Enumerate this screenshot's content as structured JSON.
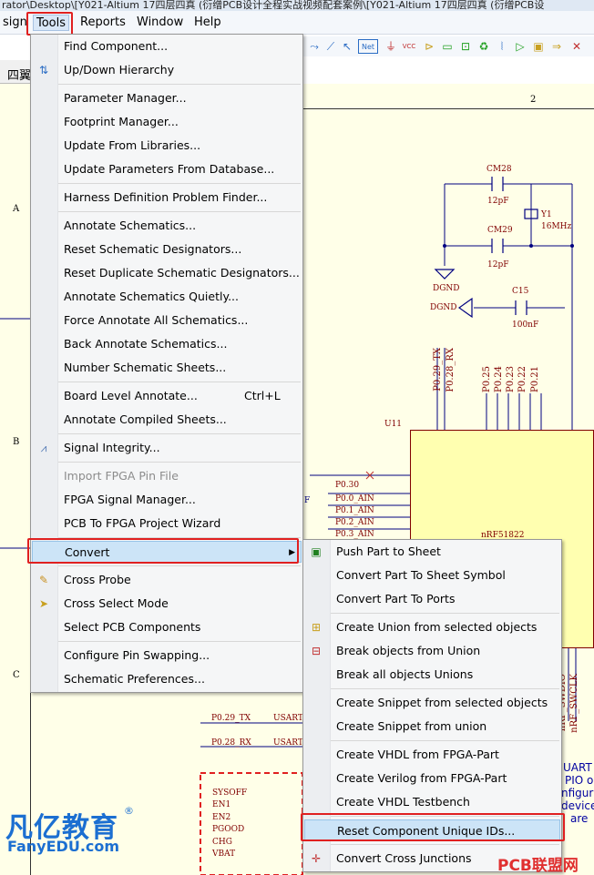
{
  "title_fragment": "rator\\Desktop\\[Y021-Altium 17四层四真 (衍缯PCB设计全程实战视频配套案例\\[Y021-Altium 17四层四真 (衍缯PCB设",
  "menubar": {
    "items": [
      {
        "label": "sign"
      },
      {
        "label": "Tools"
      },
      {
        "label": "Reports"
      },
      {
        "label": "Window"
      },
      {
        "label": "Help"
      }
    ]
  },
  "tab": {
    "label": "四翼"
  },
  "toolbar": {
    "net_label": "Net",
    "vcc_label": "VCC"
  },
  "frame": {
    "col2": "2",
    "row_a": "A",
    "row_b": "B",
    "row_c": "C"
  },
  "schematic": {
    "cm28": "CM28",
    "cm28_val": "12pF",
    "cm29": "CM29",
    "cm29_val": "12pF",
    "y1": "Y1",
    "y1_val": "16MHz",
    "dgnd1": "DGND",
    "dgnd2": "DGND",
    "c15": "C15",
    "c15_val": "100nF",
    "u11": "U11",
    "chip_name": "nRF51822",
    "pins_top": [
      "P0.29_TX",
      "P0.28_RX",
      "P0.25",
      "P0.24",
      "P0.23",
      "P0.22",
      "P0.21"
    ],
    "pins_left": [
      "P0.30",
      "P0.0_AIN",
      "P0.1_AIN",
      "P0.2_AIN",
      "P0.3_AIN"
    ],
    "pins_bottom": [
      "nRF_SWDIO",
      "nRF_SWCLK"
    ],
    "nets": [
      "P0.29_TX",
      "P0.28_RX"
    ],
    "usart": [
      "USART",
      "USART"
    ],
    "power": [
      "SYSOFF",
      "EN1",
      "EN2",
      "PGOOD",
      "CHG",
      "VBAT"
    ],
    "right_text": [
      "UART in",
      "PIO or",
      "nfigura",
      "device",
      "are"
    ],
    "f_label": "F"
  },
  "tools_menu": {
    "items": [
      {
        "label": "Find Component...",
        "icon": ""
      },
      {
        "label": "Up/Down Hierarchy",
        "icon": "updown-icon"
      },
      {
        "label": "Parameter Manager..."
      },
      {
        "label": "Footprint Manager..."
      },
      {
        "label": "Update From Libraries..."
      },
      {
        "label": "Update Parameters From Database..."
      },
      {
        "label": "Harness Definition Problem Finder..."
      },
      {
        "label": "Annotate Schematics..."
      },
      {
        "label": "Reset Schematic Designators..."
      },
      {
        "label": "Reset Duplicate Schematic Designators..."
      },
      {
        "label": "Annotate Schematics Quietly..."
      },
      {
        "label": "Force Annotate All Schematics..."
      },
      {
        "label": "Back Annotate Schematics..."
      },
      {
        "label": "Number Schematic Sheets..."
      },
      {
        "label": "Board Level Annotate...",
        "shortcut": "Ctrl+L"
      },
      {
        "label": "Annotate Compiled Sheets..."
      },
      {
        "label": "Signal Integrity...",
        "icon": "signal-integrity-icon"
      },
      {
        "label": "Import FPGA Pin File",
        "disabled": true
      },
      {
        "label": "FPGA Signal Manager..."
      },
      {
        "label": "PCB To FPGA Project Wizard"
      },
      {
        "label": "Convert",
        "submenu": true
      },
      {
        "label": "Cross Probe",
        "icon": "cross-probe-icon"
      },
      {
        "label": "Cross Select Mode",
        "icon": "cross-select-icon"
      },
      {
        "label": "Select PCB Components"
      },
      {
        "label": "Configure Pin Swapping..."
      },
      {
        "label": "Schematic Preferences..."
      }
    ]
  },
  "convert_menu": {
    "items": [
      {
        "label": "Push Part to Sheet",
        "icon": "push-part-icon"
      },
      {
        "label": "Convert Part To Sheet Symbol"
      },
      {
        "label": "Convert Part To Ports"
      },
      {
        "label": "Create Union from selected objects",
        "icon": "union-icon"
      },
      {
        "label": "Break objects from Union",
        "icon": "break-union-icon"
      },
      {
        "label": "Break all objects Unions"
      },
      {
        "label": "Create Snippet from selected objects"
      },
      {
        "label": "Create Snippet from union"
      },
      {
        "label": "Create VHDL from FPGA-Part"
      },
      {
        "label": "Create Verilog from FPGA-Part"
      },
      {
        "label": "Create VHDL Testbench"
      },
      {
        "label": "Reset Component Unique IDs..."
      },
      {
        "label": "Convert Cross Junctions",
        "icon": "cross-junction-icon"
      }
    ]
  },
  "watermarks": {
    "brand_cn": "凡亿教育",
    "brand_en": "FanyEDU.com",
    "pcb": "PCB联盟网"
  },
  "colors": {
    "highlight": "#cce4f7",
    "annotation_red": "#e02020",
    "wire_blue": "#000080",
    "part_red": "#800000"
  }
}
